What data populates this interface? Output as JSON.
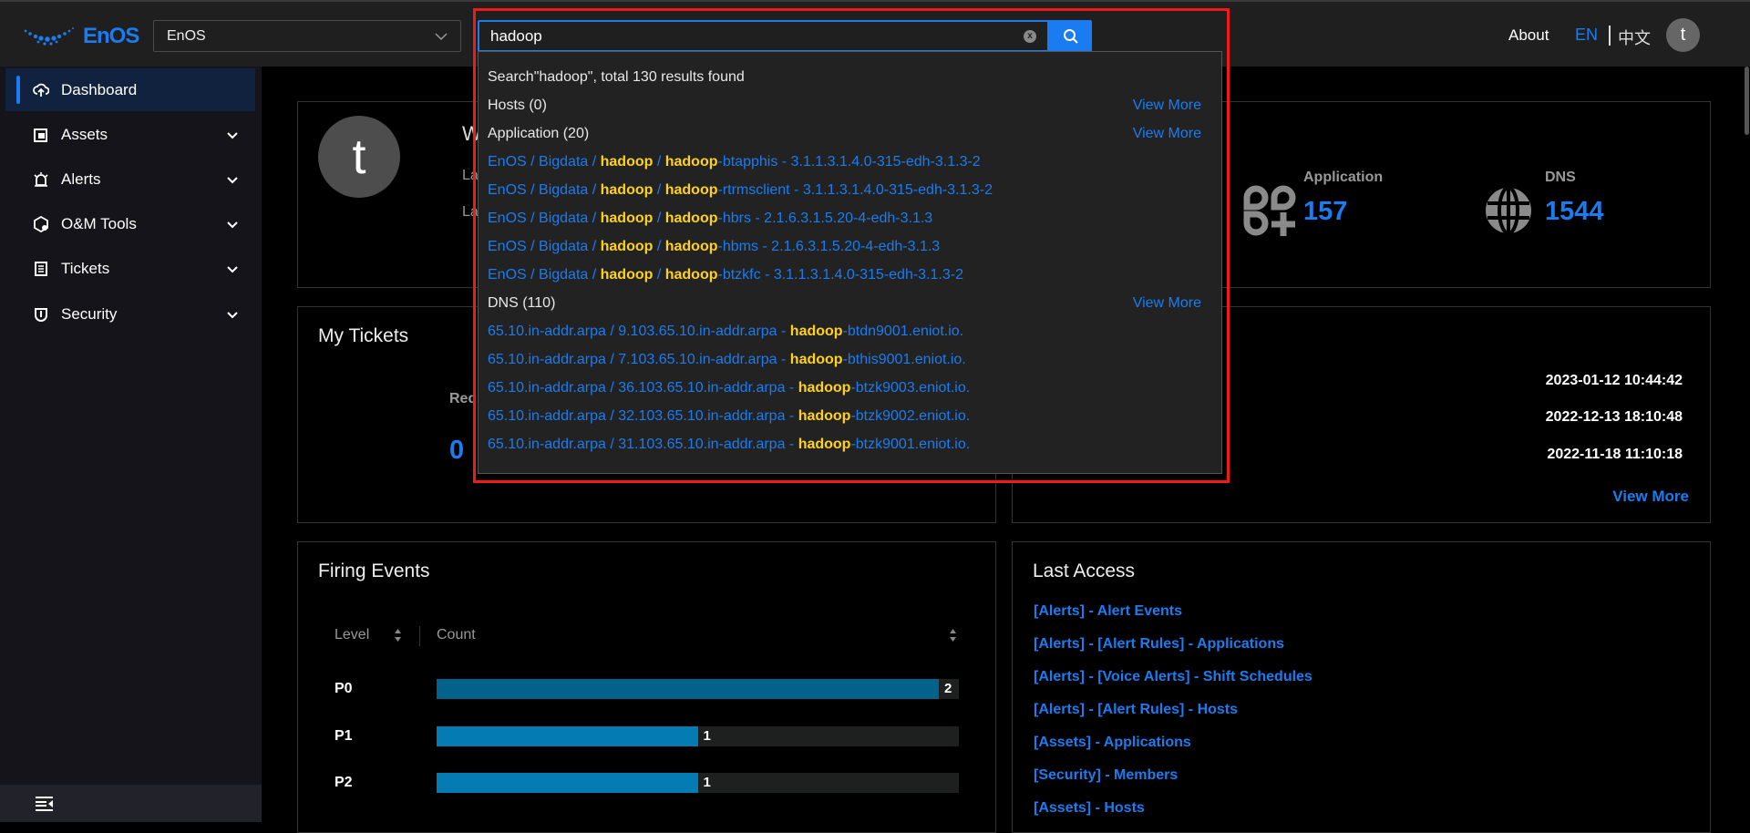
{
  "header": {
    "logo_text": "EnOS",
    "org_select": "EnOS",
    "search_value": "hadoop",
    "about": "About",
    "lang_en": "EN",
    "lang_zh": "中文",
    "avatar_letter": "t",
    "accent": "#1a7cf0"
  },
  "search_dropdown": {
    "summary": "Search\"hadoop\", total 130 results found",
    "view_more": "View More",
    "groups": [
      {
        "title": "Hosts (0)",
        "items": []
      },
      {
        "title": "Application (20)",
        "items": [
          [
            {
              "t": "EnOS / Bigdata / "
            },
            {
              "t": "hadoop",
              "h": true
            },
            {
              "t": " / "
            },
            {
              "t": "hadoop",
              "h": true
            },
            {
              "t": "-btapphis - 3.1.1.3.1.4.0-315-edh-3.1.3-2"
            }
          ],
          [
            {
              "t": "EnOS / Bigdata / "
            },
            {
              "t": "hadoop",
              "h": true
            },
            {
              "t": " / "
            },
            {
              "t": "hadoop",
              "h": true
            },
            {
              "t": "-rtrmsclient - 3.1.1.3.1.4.0-315-edh-3.1.3-2"
            }
          ],
          [
            {
              "t": "EnOS / Bigdata / "
            },
            {
              "t": "hadoop",
              "h": true
            },
            {
              "t": " / "
            },
            {
              "t": "hadoop",
              "h": true
            },
            {
              "t": "-hbrs - 2.1.6.3.1.5.20-4-edh-3.1.3"
            }
          ],
          [
            {
              "t": "EnOS / Bigdata / "
            },
            {
              "t": "hadoop",
              "h": true
            },
            {
              "t": " / "
            },
            {
              "t": "hadoop",
              "h": true
            },
            {
              "t": "-hbms - 2.1.6.3.1.5.20-4-edh-3.1.3"
            }
          ],
          [
            {
              "t": "EnOS / Bigdata / "
            },
            {
              "t": "hadoop",
              "h": true
            },
            {
              "t": " / "
            },
            {
              "t": "hadoop",
              "h": true
            },
            {
              "t": "-btzkfc - 3.1.1.3.1.4.0-315-edh-3.1.3-2"
            }
          ]
        ]
      },
      {
        "title": "DNS (110)",
        "items": [
          [
            {
              "t": "65.10.in-addr.arpa / 9.103.65.10.in-addr.arpa - "
            },
            {
              "t": "hadoop",
              "h": true
            },
            {
              "t": "-btdn9001.eniot.io."
            }
          ],
          [
            {
              "t": "65.10.in-addr.arpa / 7.103.65.10.in-addr.arpa - "
            },
            {
              "t": "hadoop",
              "h": true
            },
            {
              "t": "-bthis9001.eniot.io."
            }
          ],
          [
            {
              "t": "65.10.in-addr.arpa / 36.103.65.10.in-addr.arpa - "
            },
            {
              "t": "hadoop",
              "h": true
            },
            {
              "t": "-btzk9003.eniot.io."
            }
          ],
          [
            {
              "t": "65.10.in-addr.arpa / 32.103.65.10.in-addr.arpa - "
            },
            {
              "t": "hadoop",
              "h": true
            },
            {
              "t": "-btzk9002.eniot.io."
            }
          ],
          [
            {
              "t": "65.10.in-addr.arpa / 31.103.65.10.in-addr.arpa - "
            },
            {
              "t": "hadoop",
              "h": true
            },
            {
              "t": "-btzk9001.eniot.io."
            }
          ]
        ]
      }
    ]
  },
  "sidebar": {
    "items": [
      {
        "label": "Dashboard",
        "icon": "cloud-upload-icon",
        "active": true
      },
      {
        "label": "Assets",
        "icon": "assets-icon"
      },
      {
        "label": "Alerts",
        "icon": "alarm-icon"
      },
      {
        "label": "O&M Tools",
        "icon": "toolbox-icon"
      },
      {
        "label": "Tickets",
        "icon": "ticket-icon"
      },
      {
        "label": "Security",
        "icon": "shield-icon"
      }
    ]
  },
  "profile_card": {
    "avatar_letter": "t",
    "welcome_fragment": "W",
    "line1_fragment": "La",
    "line2_fragment": "La",
    "stats": [
      {
        "label": "Application",
        "value": "157",
        "icon": "application-icon"
      },
      {
        "label": "DNS",
        "value": "1544",
        "icon": "globe-icon"
      }
    ]
  },
  "my_tickets": {
    "title": "My Tickets",
    "label_fragment": "Req",
    "value": "0"
  },
  "activity_card": {
    "dates": [
      "2023-01-12 10:44:42",
      "2022-12-13 18:10:48",
      "2022-11-18 11:10:18"
    ],
    "view_more": "View More"
  },
  "firing_events": {
    "title": "Firing Events",
    "col_level": "Level",
    "col_count": "Count",
    "rows": [
      {
        "level": "P0",
        "count": 2,
        "color": "#03628c"
      },
      {
        "level": "P1",
        "count": 1,
        "color": "#047bb3"
      },
      {
        "level": "P2",
        "count": 1,
        "color": "#047bb3"
      }
    ]
  },
  "last_access": {
    "title": "Last Access",
    "links": [
      "[Alerts] - Alert Events",
      "[Alerts] - [Alert Rules] - Applications",
      "[Alerts] - [Voice Alerts] - Shift Schedules",
      "[Alerts] - [Alert Rules] - Hosts",
      "[Assets] - Applications",
      "[Security] - Members",
      "[Assets] - Hosts"
    ]
  }
}
